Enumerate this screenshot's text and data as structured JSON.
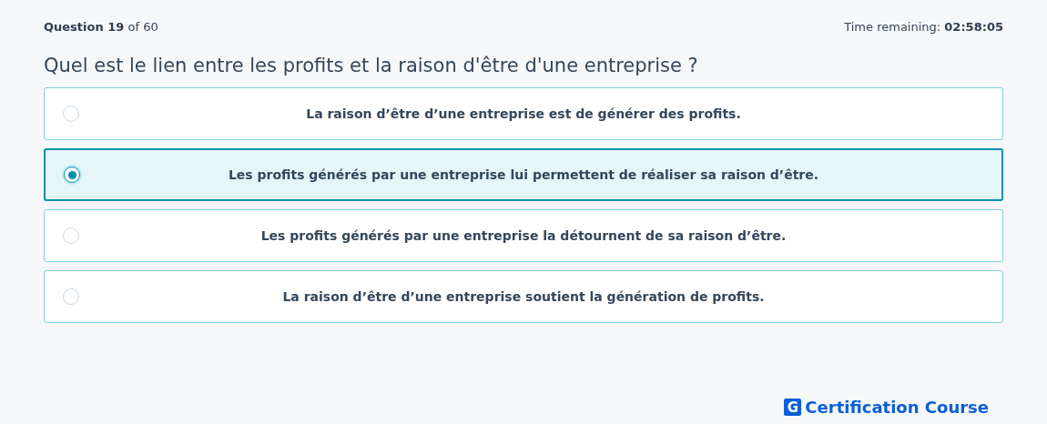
{
  "header": {
    "question_label": "Question",
    "question_number": "19",
    "of_text": "of 60",
    "time_label": "Time remaining:",
    "time_value": "02:58:05"
  },
  "question": "Quel est le lien entre les profits et la raison d'être d'une entreprise ?",
  "options": [
    {
      "label": "La raison d’être d’une entreprise est de générer des profits.",
      "selected": false
    },
    {
      "label": "Les profits générés par une entreprise lui permettent de réaliser sa raison d’être.",
      "selected": true
    },
    {
      "label": "Les profits générés par une entreprise la détournent de sa raison d’être.",
      "selected": false
    },
    {
      "label": "La raison d’être d’une entreprise soutient la génération de profits.",
      "selected": false
    }
  ],
  "brand": {
    "mark": "G",
    "name": "Certification Course"
  }
}
